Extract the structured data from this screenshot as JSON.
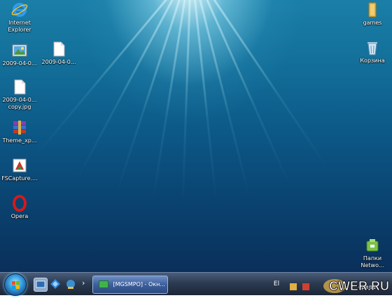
{
  "desktop": {
    "icons_left": [
      {
        "label": "Internet Explorer",
        "icon": "internet-explorer-icon"
      },
      {
        "label": "2009-04-0...",
        "icon": "image-file-icon"
      },
      {
        "label": "2009-04-0...",
        "icon": "document-file-icon"
      },
      {
        "label": "2009-04-0... copy.jpg",
        "icon": "document-file-icon"
      },
      {
        "label": "Theme_xp...",
        "icon": "winrar-archive-icon"
      },
      {
        "label": "FSCapture....",
        "icon": "fscapture-icon"
      },
      {
        "label": "Opera",
        "icon": "opera-icon"
      }
    ],
    "icons_right": [
      {
        "label": "games",
        "icon": "folder-icon"
      },
      {
        "label": "Корзина",
        "icon": "recycle-bin-icon"
      },
      {
        "label": "Папки Netwo...",
        "icon": "network-folder-icon"
      }
    ]
  },
  "taskbar": {
    "start_icon": "windows-start-orb-icon",
    "quick_launch": [
      "show-desktop-icon",
      "browser-icon",
      "network-icon"
    ],
    "chevron": "›",
    "task": {
      "label": "[MGSMPO] - Окн..."
    },
    "language": "El",
    "tray_text": "среда"
  },
  "watermark": {
    "text": "CWER.RU"
  }
}
